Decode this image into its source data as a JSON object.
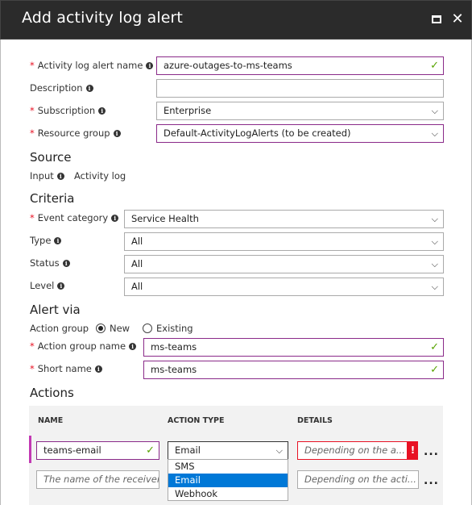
{
  "window": {
    "title": "Add activity log alert"
  },
  "form": {
    "alert_name_label": "Activity log alert name",
    "alert_name_value": "azure-outages-to-ms-teams",
    "description_label": "Description",
    "description_value": "",
    "subscription_label": "Subscription",
    "subscription_value": "Enterprise",
    "resource_group_label": "Resource group",
    "resource_group_value": "Default-ActivityLogAlerts (to be created)"
  },
  "source": {
    "heading": "Source",
    "input_label": "Input",
    "input_value": "Activity log"
  },
  "criteria": {
    "heading": "Criteria",
    "event_category_label": "Event category",
    "event_category_value": "Service Health",
    "type_label": "Type",
    "type_value": "All",
    "status_label": "Status",
    "status_value": "All",
    "level_label": "Level",
    "level_value": "All"
  },
  "alert_via": {
    "heading": "Alert via",
    "action_group_label": "Action group",
    "option_new": "New",
    "option_existing": "Existing",
    "selected": "New",
    "action_group_name_label": "Action group name",
    "action_group_name_value": "ms-teams",
    "short_name_label": "Short name",
    "short_name_value": "ms-teams"
  },
  "actions": {
    "heading": "Actions",
    "columns": [
      "NAME",
      "ACTION TYPE",
      "DETAILS"
    ],
    "row1": {
      "name": "teams-email",
      "action_type": "Email",
      "details_placeholder": "Depending on the a..."
    },
    "row2": {
      "name_placeholder": "The name of the receiver",
      "details_placeholder": "Depending on the acti..."
    },
    "action_type_options": [
      "SMS",
      "Email",
      "Webhook"
    ],
    "highlighted_option": "Email",
    "error_mark": "!",
    "more_label": "..."
  },
  "colors": {
    "titlebar": "#2b2b2b",
    "required": "#e81123",
    "valid_border": "#8a2a89",
    "check": "#57a300",
    "selection": "#0078d7"
  }
}
